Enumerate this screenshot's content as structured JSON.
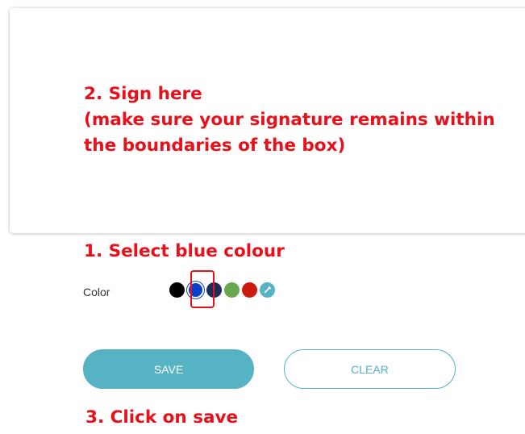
{
  "annotations": {
    "sign_line1": "2. Sign here",
    "sign_line2": "(make sure your signature remains within",
    "sign_line3": "the boundaries of the box)",
    "select": "1. Select blue colour",
    "save": "3. Click on save"
  },
  "color_picker": {
    "label": "Color",
    "swatches": [
      {
        "name": "black",
        "color": "#000000",
        "selected": false
      },
      {
        "name": "blue",
        "color": "#0a3fc8",
        "selected": true
      },
      {
        "name": "navy",
        "color": "#1c2a5c",
        "selected": false
      },
      {
        "name": "green",
        "color": "#6aa84f",
        "selected": false
      },
      {
        "name": "red",
        "color": "#cc1a0f",
        "selected": false
      }
    ],
    "custom_picker": {
      "icon": "eyedropper-icon",
      "color": "#55b3c4"
    }
  },
  "buttons": {
    "save_label": "SAVE",
    "clear_label": "CLEAR"
  },
  "colors": {
    "accent": "#55b3c4",
    "annotation": "#e8101b"
  }
}
